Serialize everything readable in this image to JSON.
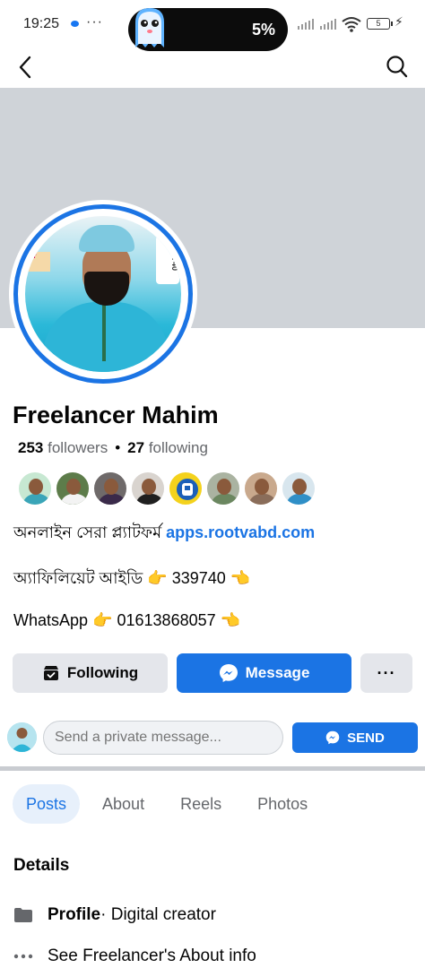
{
  "status_bar": {
    "time": "19:25",
    "more": "···",
    "battery_pill_percent": "5%",
    "battery_level": "5"
  },
  "profile": {
    "name": "Freelancer Mahim",
    "followers_count": "253",
    "followers_label": "followers",
    "following_count": "27",
    "following_label": "following",
    "avatar_tag_text": "39740",
    "avatar_sticker_text": "der"
  },
  "bio": {
    "line1_text": "অনলাইন সেরা প্ল্যাটফর্ম",
    "line1_link": "apps.rootvabd.com",
    "line2_text": "অ্যাফিলিয়েট আইডি",
    "line2_value": "339740",
    "line3_text": "WhatsApp",
    "line3_value": "01613868057",
    "emoji_right": "👉",
    "emoji_left": "👈"
  },
  "actions": {
    "following_label": "Following",
    "message_label": "Message",
    "more_label": "···"
  },
  "private_message": {
    "placeholder": "Send a private message...",
    "send_label": "SEND"
  },
  "tabs": [
    {
      "label": "Posts",
      "active": true
    },
    {
      "label": "About",
      "active": false
    },
    {
      "label": "Reels",
      "active": false
    },
    {
      "label": "Photos",
      "active": false
    }
  ],
  "details": {
    "title": "Details",
    "profile_label": "Profile",
    "profile_type": " · Digital creator",
    "see_about": "See Freelancer's About info"
  },
  "colors": {
    "accent": "#1b74e4",
    "cover": "#cfd3d8",
    "button_gray": "#e4e6eb"
  }
}
